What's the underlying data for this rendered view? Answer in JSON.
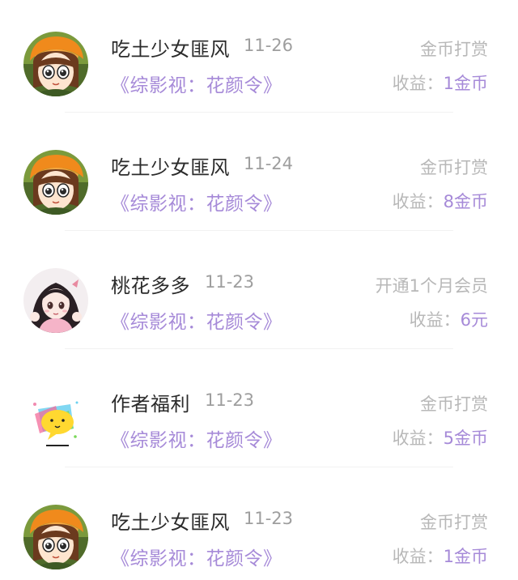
{
  "rows": [
    {
      "name": "吃土少女匪风",
      "date": "11-26",
      "book": "《综影视：花颜令》",
      "type": "金币打赏",
      "income_label": "收益：",
      "income_value": "1金币",
      "avatar": "girl-orange-hat-avatar"
    },
    {
      "name": "吃土少女匪风",
      "date": "11-24",
      "book": "《综影视：花颜令》",
      "type": "金币打赏",
      "income_label": "收益：",
      "income_value": "8金币",
      "avatar": "girl-orange-hat-avatar"
    },
    {
      "name": "桃花多多",
      "date": "11-23",
      "book": "《综影视：花颜令》",
      "type": "开通1个月会员",
      "income_label": "收益：",
      "income_value": "6元",
      "avatar": "anime-girl-pink-avatar"
    },
    {
      "name": "作者福利",
      "date": "11-23",
      "book": "《综影视：花颜令》",
      "type": "金币打赏",
      "income_label": "收益：",
      "income_value": "5金币",
      "avatar": "yellow-chat-bubble-avatar"
    },
    {
      "name": "吃土少女匪风",
      "date": "11-23",
      "book": "《综影视：花颜令》",
      "type": "金币打赏",
      "income_label": "收益：",
      "income_value": "1金币",
      "avatar": "girl-orange-hat-avatar"
    }
  ],
  "colors": {
    "accent": "#a68ad8",
    "name_text": "#2b2b2b",
    "secondary_text": "#b8b8b8",
    "date_text": "#9e9e9e"
  }
}
